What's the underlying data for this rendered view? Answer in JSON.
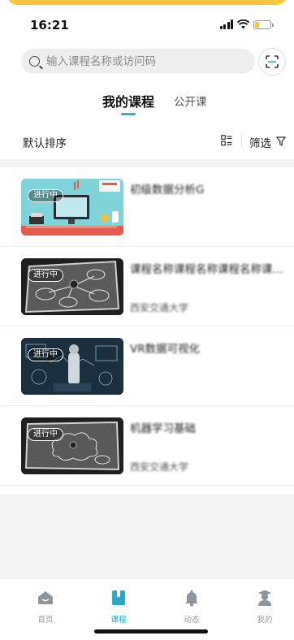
{
  "status_bar": {
    "time": "16:21"
  },
  "search": {
    "placeholder": "输入课程名称或访问码"
  },
  "tabs": [
    {
      "label": "我的课程",
      "active": true
    },
    {
      "label": "公开课",
      "active": false
    }
  ],
  "filter_bar": {
    "sort_label": "默认排序",
    "filter_label": "筛选"
  },
  "courses": [
    {
      "status": "进行中",
      "title": "初级数据分析G",
      "subtitle": ""
    },
    {
      "status": "进行中",
      "title": "课程名称课程名称课程名称课程名称…",
      "subtitle": "西安交通大学"
    },
    {
      "status": "进行中",
      "title": "VR数据可视化",
      "subtitle": ""
    },
    {
      "status": "进行中",
      "title": "机器学习基础",
      "subtitle": "西安交通大学"
    }
  ],
  "tab_bar": [
    {
      "label": "首页",
      "icon": "home-icon",
      "active": false
    },
    {
      "label": "课程",
      "icon": "course-book-icon",
      "active": true
    },
    {
      "label": "动态",
      "icon": "bell-icon",
      "active": false
    },
    {
      "label": "我的",
      "icon": "profile-graduate-icon",
      "active": false
    }
  ],
  "colors": {
    "accent": "#2fb3c9",
    "tab_active": "#2aa7c4",
    "top_banner": "#f7c63d"
  }
}
